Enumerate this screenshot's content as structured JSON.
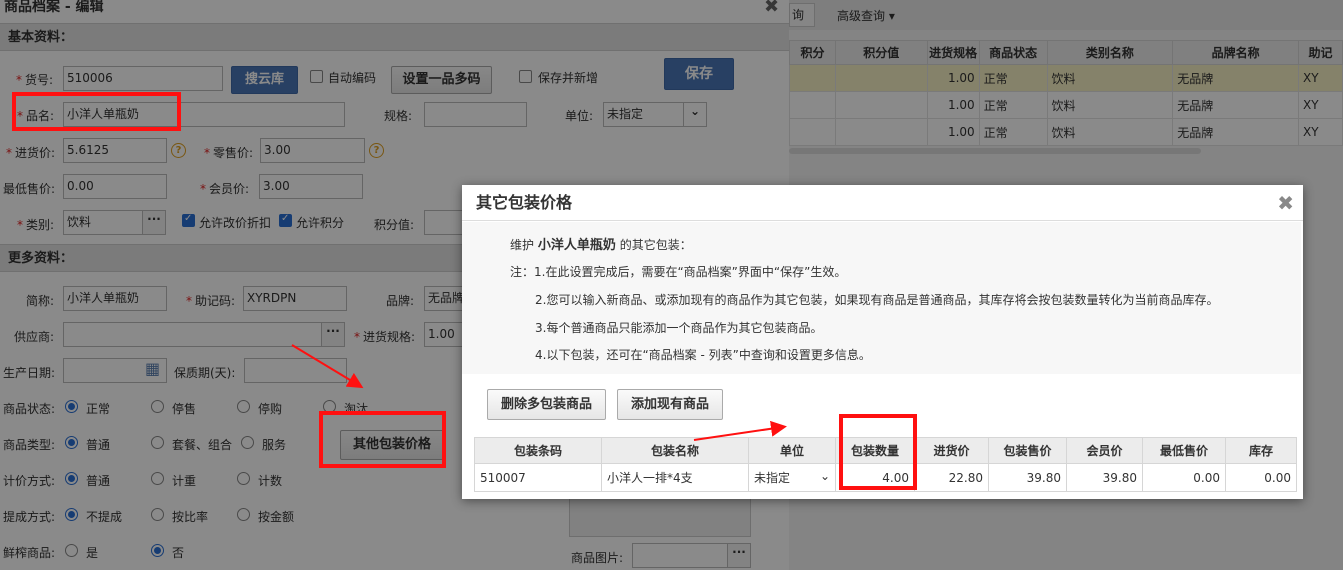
{
  "bg_window": {
    "query_btn": "询",
    "advanced": "高级查询 ▾",
    "headers": [
      "积分",
      "积分值",
      "进货规格",
      "商品状态",
      "类别名称",
      "品牌名称",
      "助记"
    ],
    "rows": [
      [
        "",
        "",
        "1.00",
        "正常",
        "饮料",
        "无品牌",
        "XY"
      ],
      [
        "",
        "",
        "1.00",
        "正常",
        "饮料",
        "无品牌",
        "XY"
      ],
      [
        "",
        "",
        "1.00",
        "正常",
        "饮料",
        "无品牌",
        "XY"
      ]
    ]
  },
  "editor": {
    "title": "商品档案 - 编辑",
    "close": "✖",
    "basic_section": "基本资料：",
    "more_section": "更多资料：",
    "code_label": "货号:",
    "code_value": "510006",
    "search_cloud": "搜云库",
    "auto_code": "自动编码",
    "multi_code": "设置一品多码",
    "save_new": "保存并新增",
    "save": "保存",
    "name_label": "品名:",
    "name_value": "小洋人单瓶奶",
    "spec_label": "规格:",
    "unit_label": "单位:",
    "unit_value": "未指定",
    "cost_label": "进货价:",
    "cost_value": "5.6125",
    "retail_label": "零售价:",
    "retail_value": "3.00",
    "min_price_label": "最低售价:",
    "min_price_value": "0.00",
    "member_label": "会员价:",
    "member_value": "3.00",
    "category_label": "类别:",
    "category_value": "饮料",
    "allow_discount": "允许改价折扣",
    "allow_points": "允许积分",
    "points_label": "积分值:",
    "short_label": "简称:",
    "short_value": "小洋人单瓶奶",
    "mnemonic_label": "助记码:",
    "mnemonic_value": "XYRDPN",
    "brand_label": "品牌:",
    "brand_value": "无品牌",
    "supplier_label": "供应商:",
    "spec_in_label": "进货规格:",
    "spec_in_value": "1.00",
    "prod_date_label": "生产日期:",
    "shelf_life_label": "保质期(天):",
    "status_label": "商品状态:",
    "status_opts": [
      "正常",
      "停售",
      "停购",
      "淘汰"
    ],
    "type_label": "商品类型:",
    "type_opts": [
      "普通",
      "套餐、组合",
      "服务"
    ],
    "pricing_label": "计价方式:",
    "pricing_opts": [
      "普通",
      "计重",
      "计数"
    ],
    "commission_label": "提成方式:",
    "commission_opts": [
      "不提成",
      "按比率",
      "按金额"
    ],
    "fresh_label": "鲜榨商品:",
    "fresh_opts": [
      "是",
      "否"
    ],
    "other_pack_btn": "其他包装价格",
    "image_label": "商品图片:"
  },
  "popup": {
    "title": "其它包装价格",
    "close": "✖",
    "intro_pre": "维护",
    "intro_name": "小洋人单瓶奶",
    "intro_post": "的其它包装：",
    "notes": [
      "注：1.在此设置完成后，需要在“商品档案”界面中“保存”生效。",
      "2.您可以输入新商品、或添加现有的商品作为其它包装，如果现有商品是普通商品，其库存将会按包装数量转化为当前商品库存。",
      "3.每个普通商品只能添加一个商品作为其它包装商品。",
      "4.以下包装，还可在“商品档案 - 列表”中查询和设置更多信息。"
    ],
    "delete_btn": "删除多包装商品",
    "add_btn": "添加现有商品",
    "headers": [
      "包装条码",
      "包装名称",
      "单位",
      "包装数量",
      "进货价",
      "包装售价",
      "会员价",
      "最低售价",
      "库存"
    ],
    "row": {
      "barcode": "510007",
      "name": "小洋人一排*4支",
      "unit": "未指定",
      "qty": "4.00",
      "cost": "22.80",
      "price": "39.80",
      "member": "39.80",
      "min": "0.00",
      "stock": "0.00"
    }
  },
  "colors": {
    "highlight": "#ff1010",
    "accent": "#4a76b8",
    "selected_row": "#f6f0c4"
  }
}
